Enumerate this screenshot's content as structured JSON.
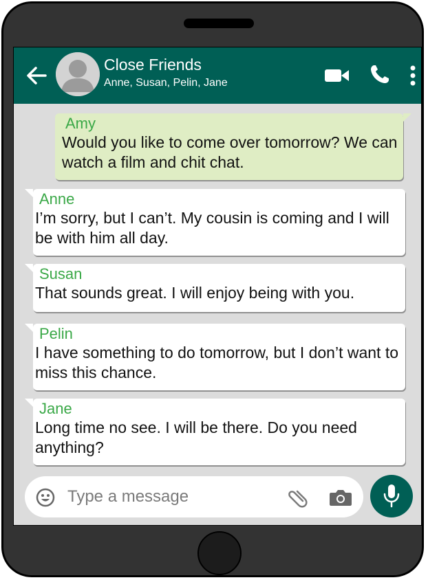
{
  "header": {
    "title": "Close Friends",
    "subtitle": "Anne, Susan, Pelin, Jane",
    "back_icon": "arrow-left-icon",
    "icons": [
      "video-call-icon",
      "phone-call-icon",
      "more-menu-icon"
    ]
  },
  "messages": [
    {
      "sender": "Amy",
      "text": "Would you like to come over tomorrow? We can watch a film and chit chat.",
      "own": true
    },
    {
      "sender": "Anne",
      "text": "I’m sorry, but I can’t. My cousin is coming and I will be with him all day.",
      "own": false
    },
    {
      "sender": "Susan",
      "text": "That sounds great. I will enjoy being with you.",
      "own": false
    },
    {
      "sender": "Pelin",
      "text": "I have something to do tomorrow, but I don’t want to miss this chance.",
      "own": false
    },
    {
      "sender": "Jane",
      "text": "Long time no see. I will be there. Do you need anything?",
      "own": false
    }
  ],
  "composer": {
    "placeholder": "Type a message",
    "value": "",
    "icons": [
      "emoji-icon",
      "paperclip-icon",
      "camera-icon",
      "microphone-icon"
    ]
  },
  "colors": {
    "header": "#005f55",
    "sender_name": "#3aa847",
    "own_bubble": "#dfedc4",
    "other_bubble": "#ffffff",
    "chat_background": "#dcdcdc",
    "phone_body": "#333333"
  }
}
